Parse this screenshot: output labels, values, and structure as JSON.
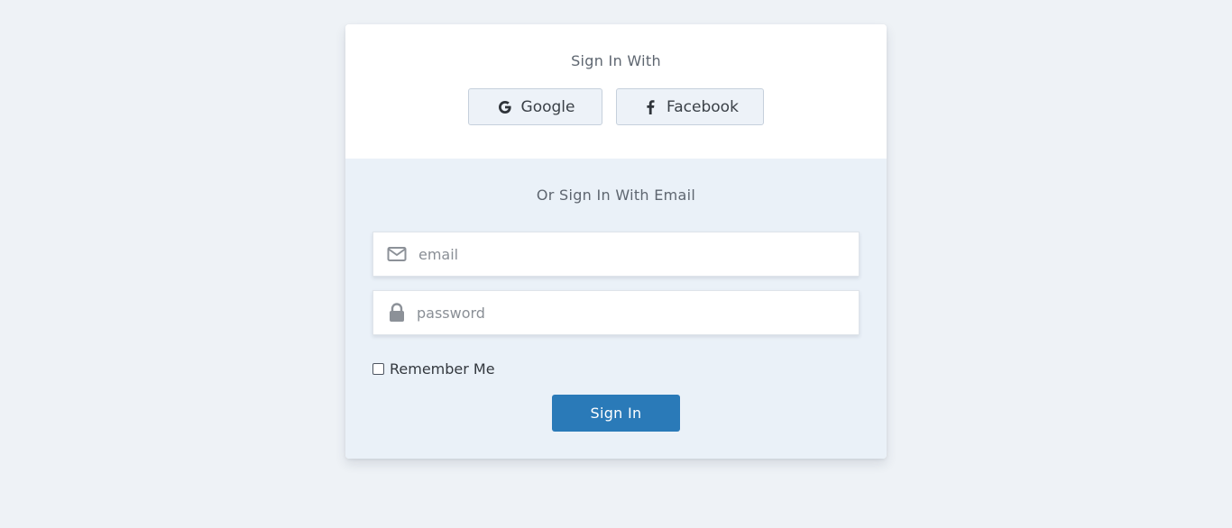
{
  "social": {
    "heading": "Sign In With",
    "google": {
      "label": "Google",
      "icon": "google-icon"
    },
    "facebook": {
      "label": "Facebook",
      "icon": "facebook-icon"
    }
  },
  "email_section": {
    "heading": "Or Sign In With Email",
    "email": {
      "placeholder": "email",
      "value": "",
      "icon": "envelope-icon"
    },
    "password": {
      "placeholder": "password",
      "value": "",
      "icon": "lock-icon"
    },
    "remember_label": "Remember Me",
    "remember_checked": false,
    "submit_label": "Sign In"
  },
  "colors": {
    "page_background": "#eef2f6",
    "card_background": "#ffffff",
    "email_section_background": "#eaf1f8",
    "social_button_background": "#edf2f8",
    "primary_button": "#2a7ab8"
  }
}
